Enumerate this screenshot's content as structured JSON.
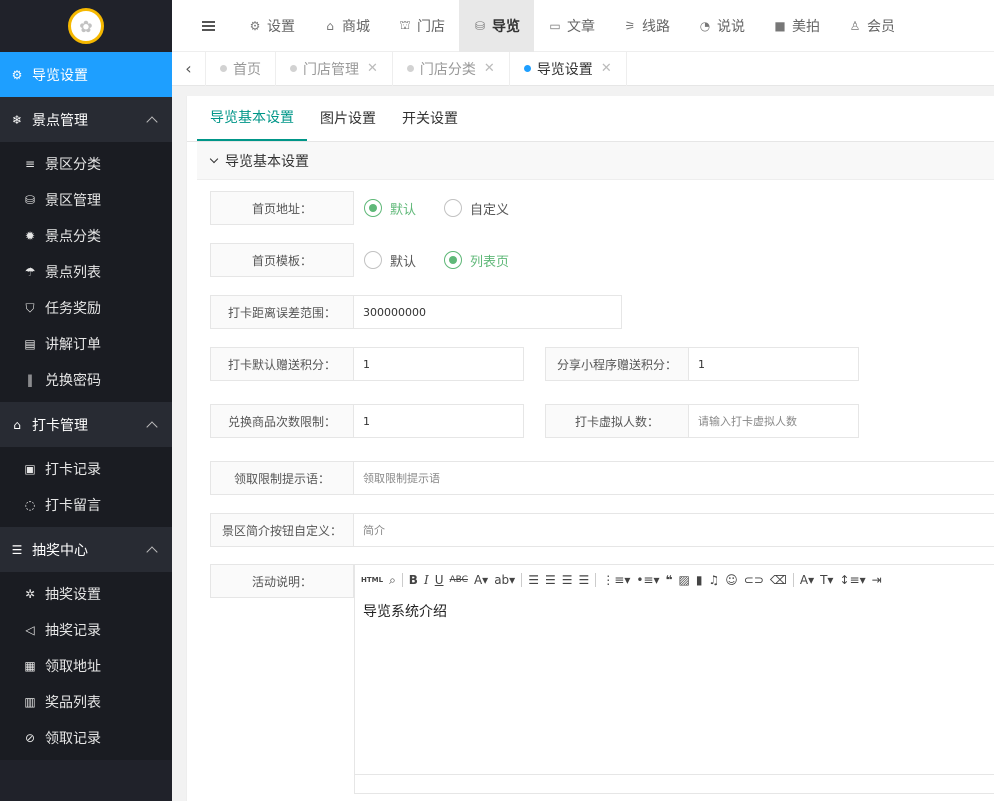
{
  "sidebar": {
    "active": {
      "label": "导览设置",
      "icon": "gears-icon"
    },
    "groups": [
      {
        "label": "景点管理",
        "icon": "snowflake-icon",
        "items": [
          {
            "label": "景区分类",
            "icon": "list-icon"
          },
          {
            "label": "景区管理",
            "icon": "cubes-icon"
          },
          {
            "label": "景点分类",
            "icon": "gear-icon"
          },
          {
            "label": "景点列表",
            "icon": "umbrella-icon"
          },
          {
            "label": "任务奖励",
            "icon": "pocket-icon"
          },
          {
            "label": "讲解订单",
            "icon": "document-icon"
          },
          {
            "label": "兑换密码",
            "icon": "barcode-icon"
          }
        ]
      },
      {
        "label": "打卡管理",
        "icon": "bank-icon",
        "items": [
          {
            "label": "打卡记录",
            "icon": "id-card-icon"
          },
          {
            "label": "打卡留言",
            "icon": "comment-icon"
          }
        ]
      },
      {
        "label": "抽奖中心",
        "icon": "database-icon",
        "items": [
          {
            "label": "抽奖设置",
            "icon": "cog-icon"
          },
          {
            "label": "抽奖记录",
            "icon": "bullhorn-icon"
          },
          {
            "label": "领取地址",
            "icon": "map-icon"
          },
          {
            "label": "奖品列表",
            "icon": "calendar-icon"
          },
          {
            "label": "领取记录",
            "icon": "eye-slash-icon"
          }
        ]
      }
    ]
  },
  "topnav": {
    "items": [
      {
        "label": "设置",
        "icon": "gears-icon"
      },
      {
        "label": "商城",
        "icon": "shop-icon"
      },
      {
        "label": "门店",
        "icon": "bank-icon"
      },
      {
        "label": "导览",
        "icon": "cubes-icon",
        "active": true
      },
      {
        "label": "文章",
        "icon": "newspaper-icon"
      },
      {
        "label": "线路",
        "icon": "road-icon"
      },
      {
        "label": "说说",
        "icon": "wechat-icon"
      },
      {
        "label": "美拍",
        "icon": "video-icon"
      },
      {
        "label": "会员",
        "icon": "user-icon"
      }
    ]
  },
  "tabs": [
    {
      "label": "首页",
      "closable": false
    },
    {
      "label": "门店管理",
      "closable": true
    },
    {
      "label": "门店分类",
      "closable": true
    },
    {
      "label": "导览设置",
      "closable": true,
      "active": true
    }
  ],
  "content_tabs": [
    "导览基本设置",
    "图片设置",
    "开关设置"
  ],
  "section_title": "导览基本设置",
  "form": {
    "home_url": {
      "label": "首页地址：",
      "options": [
        "默认",
        "自定义"
      ],
      "selected": "默认"
    },
    "home_tpl": {
      "label": "首页模板：",
      "options": [
        "默认",
        "列表页"
      ],
      "selected": "列表页"
    },
    "checkin_range": {
      "label": "打卡距离误差范围：",
      "value": "300000000"
    },
    "checkin_points": {
      "label": "打卡默认赠送积分：",
      "value": "1"
    },
    "share_points": {
      "label": "分享小程序赠送积分：",
      "value": "1"
    },
    "exchange_limit": {
      "label": "兑换商品次数限制：",
      "value": "1"
    },
    "virtual_count": {
      "label": "打卡虚拟人数：",
      "placeholder": "请输入打卡虚拟人数"
    },
    "claim_tip": {
      "label": "领取限制提示语：",
      "placeholder": "领取限制提示语"
    },
    "intro_btn": {
      "label": "景区简介按钮自定义：",
      "placeholder": "简介"
    },
    "activity": {
      "label": "活动说明：",
      "content": "导览系统介绍"
    }
  },
  "colors": {
    "sidebar_bg": "#20222a",
    "accent_blue": "#1e9fff",
    "tab_green": "#009688",
    "radio_green": "#5fb878"
  }
}
